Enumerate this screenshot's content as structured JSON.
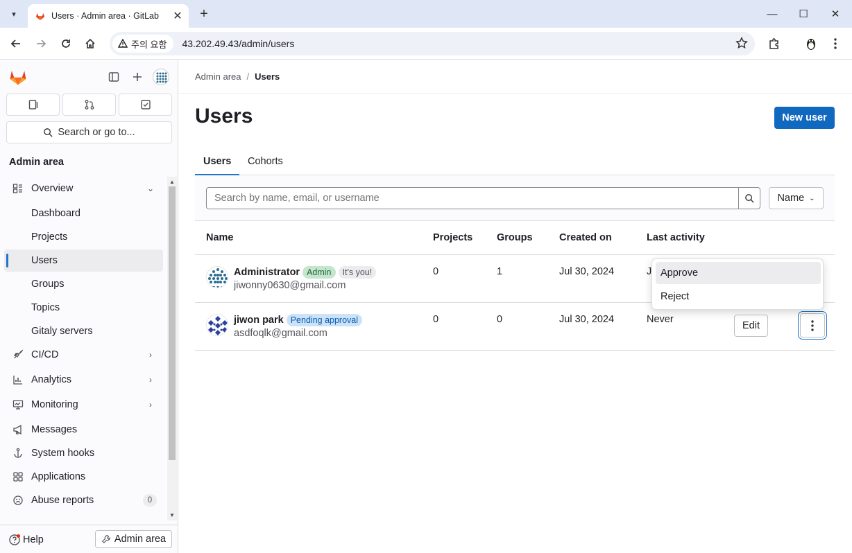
{
  "browser": {
    "tab_title": "Users · Admin area · GitLab",
    "security_label": "주의 요함",
    "url": "43.202.49.43/admin/users"
  },
  "sidebar": {
    "search_label": "Search or go to...",
    "section_title": "Admin area",
    "items": [
      {
        "label": "Overview",
        "icon": "overview-icon",
        "expanded": true
      },
      {
        "label": "Dashboard",
        "sub": true
      },
      {
        "label": "Projects",
        "sub": true
      },
      {
        "label": "Users",
        "sub": true,
        "active": true
      },
      {
        "label": "Groups",
        "sub": true
      },
      {
        "label": "Topics",
        "sub": true
      },
      {
        "label": "Gitaly servers",
        "sub": true
      },
      {
        "label": "CI/CD",
        "icon": "rocket-icon"
      },
      {
        "label": "Analytics",
        "icon": "chart-icon"
      },
      {
        "label": "Monitoring",
        "icon": "monitor-icon"
      },
      {
        "label": "Messages",
        "icon": "bullhorn-icon"
      },
      {
        "label": "System hooks",
        "icon": "anchor-icon"
      },
      {
        "label": "Applications",
        "icon": "applications-icon"
      },
      {
        "label": "Abuse reports",
        "icon": "abuse-icon",
        "count": "0"
      }
    ],
    "help_label": "Help",
    "admin_button_label": "Admin area"
  },
  "breadcrumb": {
    "parent": "Admin area",
    "current": "Users"
  },
  "page": {
    "title": "Users",
    "new_user_label": "New user",
    "tabs": [
      "Users",
      "Cohorts"
    ],
    "search_placeholder": "Search by name, email, or username",
    "sort_label": "Name"
  },
  "table": {
    "columns": [
      "Name",
      "Projects",
      "Groups",
      "Created on",
      "Last activity"
    ],
    "rows": [
      {
        "name": "Administrator",
        "badges": [
          "Admin",
          "It's you!"
        ],
        "email": "jiwonny0630@gmail.com",
        "projects": "0",
        "groups": "1",
        "created_on": "Jul 30, 2024",
        "last_activity": "J"
      },
      {
        "name": "jiwon park",
        "badges": [
          "Pending approval"
        ],
        "email": "asdfoqlk@gmail.com",
        "projects": "0",
        "groups": "0",
        "created_on": "Jul 30, 2024",
        "last_activity": "Never",
        "edit_label": "Edit"
      }
    ]
  },
  "dropdown": {
    "items": [
      "Approve",
      "Reject"
    ]
  },
  "colors": {
    "primary": "#1068bf",
    "gitlab_orange": "#e24329"
  }
}
